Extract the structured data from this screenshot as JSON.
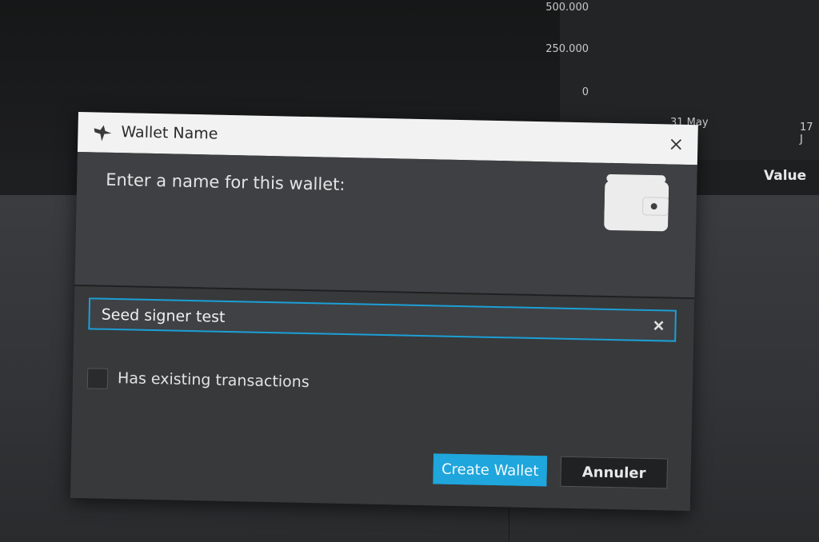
{
  "background": {
    "y_ticks": [
      "500.000",
      "250.000",
      "0"
    ],
    "date_ticks": [
      "31 May",
      "17 J"
    ],
    "table_column": "Value"
  },
  "dialog": {
    "title": "Wallet Name",
    "prompt": "Enter a name for this wallet:",
    "name_value": "Seed signer test",
    "name_placeholder": "",
    "checkbox_label": "Has existing transactions",
    "checkbox_checked": false,
    "create_button": "Create Wallet",
    "cancel_button": "Annuler",
    "icons": {
      "app": "sparrow-bird-icon",
      "close": "close-icon",
      "wallet": "wallet-icon",
      "clear": "clear-icon"
    }
  },
  "colors": {
    "accent": "#1fa6dc",
    "dialog_bg": "#38393b",
    "titlebar_bg": "#f2f2f2"
  }
}
